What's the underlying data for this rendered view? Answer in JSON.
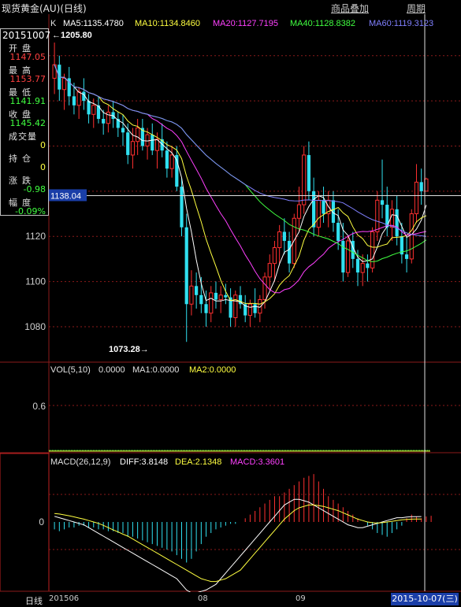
{
  "window": {
    "title": "现货黄金(AU)(日线)"
  },
  "menu": {
    "overlay": "商品叠加",
    "period": "周期"
  },
  "info_panel": {
    "date": "20151007",
    "open_label": "开盘",
    "open": "1147.05",
    "high_label": "最高",
    "high": "1153.77",
    "low_label": "最低",
    "low": "1141.91",
    "close_label": "收盘",
    "close": "1145.42",
    "volume_label": "成交量",
    "volume": "0",
    "position_label": "持仓",
    "position": "0",
    "change_label": "涨跌",
    "change": "-0.98",
    "pct_label": "幅度",
    "pct": "-0.09%"
  },
  "main_legend": {
    "k": "K",
    "ma5": "MA5:1135.4780",
    "ma10": "MA10:1134.8460",
    "ma20": "MA20:1127.7195",
    "ma40": "MA40:1128.8382",
    "ma60": "MA60:1119.3123"
  },
  "price_axis": [
    "1120",
    "1100",
    "1080"
  ],
  "cursor_price": "1138.04",
  "max_label": "1205.80",
  "min_label": "1073.28",
  "vol_legend": {
    "vol": "VOL(5,10)",
    "v": "0.0000",
    "ma1": "MA1:0.0000",
    "ma2": "MA2:0.0000"
  },
  "vol_axis": [
    "0.6"
  ],
  "macd_legend": {
    "name": "MACD(26,12,9)",
    "diff": "DIFF:3.8148",
    "dea": "DEA:2.1348",
    "macd": "MACD:3.3601"
  },
  "macd_axis": [
    "0"
  ],
  "time_axis": {
    "tab": "日线",
    "t1": "201506",
    "t2": "08",
    "t3": "09",
    "current": "2015-10-07(三)"
  },
  "colors": {
    "up": "#ff3030",
    "down": "#30e0f0",
    "ma5": "#ffffff",
    "ma10": "#ffff40",
    "ma20": "#ff40ff",
    "ma40": "#40ff40",
    "ma60": "#8080ff",
    "grid": "#8b1a1a"
  },
  "chart_data": {
    "type": "candlestick",
    "ma_periods": [
      5,
      10,
      20,
      40,
      60
    ],
    "candles": [
      {
        "o": 1190,
        "h": 1205.8,
        "l": 1183,
        "c": 1196
      },
      {
        "o": 1196,
        "h": 1200,
        "l": 1180,
        "c": 1185
      },
      {
        "o": 1185,
        "h": 1192,
        "l": 1176,
        "c": 1190
      },
      {
        "o": 1190,
        "h": 1195,
        "l": 1178,
        "c": 1182
      },
      {
        "o": 1182,
        "h": 1188,
        "l": 1174,
        "c": 1178
      },
      {
        "o": 1178,
        "h": 1186,
        "l": 1172,
        "c": 1184
      },
      {
        "o": 1184,
        "h": 1190,
        "l": 1176,
        "c": 1180
      },
      {
        "o": 1180,
        "h": 1183,
        "l": 1170,
        "c": 1174
      },
      {
        "o": 1174,
        "h": 1181,
        "l": 1168,
        "c": 1178
      },
      {
        "o": 1178,
        "h": 1182,
        "l": 1170,
        "c": 1172
      },
      {
        "o": 1172,
        "h": 1176,
        "l": 1165,
        "c": 1170
      },
      {
        "o": 1170,
        "h": 1178,
        "l": 1166,
        "c": 1175
      },
      {
        "o": 1175,
        "h": 1180,
        "l": 1168,
        "c": 1172
      },
      {
        "o": 1172,
        "h": 1175,
        "l": 1164,
        "c": 1168
      },
      {
        "o": 1168,
        "h": 1174,
        "l": 1160,
        "c": 1166
      },
      {
        "o": 1166,
        "h": 1170,
        "l": 1152,
        "c": 1156
      },
      {
        "o": 1156,
        "h": 1168,
        "l": 1150,
        "c": 1162
      },
      {
        "o": 1162,
        "h": 1172,
        "l": 1156,
        "c": 1168
      },
      {
        "o": 1168,
        "h": 1172,
        "l": 1158,
        "c": 1160
      },
      {
        "o": 1160,
        "h": 1168,
        "l": 1154,
        "c": 1165
      },
      {
        "o": 1165,
        "h": 1170,
        "l": 1156,
        "c": 1158
      },
      {
        "o": 1158,
        "h": 1166,
        "l": 1150,
        "c": 1163
      },
      {
        "o": 1163,
        "h": 1170,
        "l": 1155,
        "c": 1158
      },
      {
        "o": 1158,
        "h": 1162,
        "l": 1146,
        "c": 1150
      },
      {
        "o": 1150,
        "h": 1160,
        "l": 1146,
        "c": 1156
      },
      {
        "o": 1156,
        "h": 1160,
        "l": 1140,
        "c": 1142
      },
      {
        "o": 1142,
        "h": 1146,
        "l": 1120,
        "c": 1124
      },
      {
        "o": 1124,
        "h": 1130,
        "l": 1073.28,
        "c": 1090
      },
      {
        "o": 1090,
        "h": 1105,
        "l": 1085,
        "c": 1098
      },
      {
        "o": 1098,
        "h": 1104,
        "l": 1088,
        "c": 1094
      },
      {
        "o": 1094,
        "h": 1102,
        "l": 1086,
        "c": 1090
      },
      {
        "o": 1090,
        "h": 1096,
        "l": 1080,
        "c": 1086
      },
      {
        "o": 1086,
        "h": 1098,
        "l": 1082,
        "c": 1095
      },
      {
        "o": 1095,
        "h": 1100,
        "l": 1088,
        "c": 1092
      },
      {
        "o": 1092,
        "h": 1098,
        "l": 1086,
        "c": 1094
      },
      {
        "o": 1094,
        "h": 1099,
        "l": 1090,
        "c": 1093
      },
      {
        "o": 1093,
        "h": 1097,
        "l": 1080,
        "c": 1084
      },
      {
        "o": 1084,
        "h": 1096,
        "l": 1080,
        "c": 1094
      },
      {
        "o": 1094,
        "h": 1098,
        "l": 1088,
        "c": 1090
      },
      {
        "o": 1090,
        "h": 1094,
        "l": 1082,
        "c": 1085
      },
      {
        "o": 1085,
        "h": 1092,
        "l": 1080,
        "c": 1090
      },
      {
        "o": 1090,
        "h": 1097,
        "l": 1084,
        "c": 1086
      },
      {
        "o": 1086,
        "h": 1094,
        "l": 1082,
        "c": 1092
      },
      {
        "o": 1092,
        "h": 1104,
        "l": 1088,
        "c": 1102
      },
      {
        "o": 1102,
        "h": 1112,
        "l": 1096,
        "c": 1108
      },
      {
        "o": 1108,
        "h": 1118,
        "l": 1100,
        "c": 1115
      },
      {
        "o": 1115,
        "h": 1125,
        "l": 1108,
        "c": 1122
      },
      {
        "o": 1122,
        "h": 1128,
        "l": 1112,
        "c": 1118
      },
      {
        "o": 1118,
        "h": 1122,
        "l": 1104,
        "c": 1108
      },
      {
        "o": 1108,
        "h": 1130,
        "l": 1106,
        "c": 1128
      },
      {
        "o": 1128,
        "h": 1142,
        "l": 1122,
        "c": 1134
      },
      {
        "o": 1134,
        "h": 1160,
        "l": 1130,
        "c": 1156
      },
      {
        "o": 1156,
        "h": 1162,
        "l": 1136,
        "c": 1140
      },
      {
        "o": 1140,
        "h": 1146,
        "l": 1120,
        "c": 1124
      },
      {
        "o": 1124,
        "h": 1140,
        "l": 1120,
        "c": 1136
      },
      {
        "o": 1136,
        "h": 1142,
        "l": 1126,
        "c": 1130
      },
      {
        "o": 1130,
        "h": 1140,
        "l": 1124,
        "c": 1136
      },
      {
        "o": 1136,
        "h": 1140,
        "l": 1122,
        "c": 1126
      },
      {
        "o": 1126,
        "h": 1132,
        "l": 1114,
        "c": 1118
      },
      {
        "o": 1118,
        "h": 1126,
        "l": 1100,
        "c": 1104
      },
      {
        "o": 1104,
        "h": 1120,
        "l": 1102,
        "c": 1118
      },
      {
        "o": 1118,
        "h": 1122,
        "l": 1106,
        "c": 1110
      },
      {
        "o": 1110,
        "h": 1114,
        "l": 1098,
        "c": 1104
      },
      {
        "o": 1104,
        "h": 1112,
        "l": 1098,
        "c": 1108
      },
      {
        "o": 1108,
        "h": 1112,
        "l": 1100,
        "c": 1106
      },
      {
        "o": 1106,
        "h": 1124,
        "l": 1104,
        "c": 1122
      },
      {
        "o": 1122,
        "h": 1140,
        "l": 1118,
        "c": 1136
      },
      {
        "o": 1136,
        "h": 1154,
        "l": 1128,
        "c": 1134
      },
      {
        "o": 1134,
        "h": 1142,
        "l": 1120,
        "c": 1124
      },
      {
        "o": 1124,
        "h": 1136,
        "l": 1118,
        "c": 1132
      },
      {
        "o": 1132,
        "h": 1138,
        "l": 1116,
        "c": 1120
      },
      {
        "o": 1120,
        "h": 1126,
        "l": 1108,
        "c": 1112
      },
      {
        "o": 1112,
        "h": 1120,
        "l": 1104,
        "c": 1110
      },
      {
        "o": 1110,
        "h": 1132,
        "l": 1108,
        "c": 1130
      },
      {
        "o": 1130,
        "h": 1152,
        "l": 1126,
        "c": 1144
      },
      {
        "o": 1144,
        "h": 1150,
        "l": 1134,
        "c": 1140
      },
      {
        "o": 1140,
        "h": 1146,
        "l": 1141.91,
        "c": 1145.42
      }
    ],
    "macd_hist": [
      -4,
      -5,
      -4,
      -3,
      -3,
      -2,
      -2,
      -3,
      -3,
      -4,
      -4,
      -5,
      -5,
      -6,
      -6,
      -8,
      -8,
      -9,
      -10,
      -11,
      -12,
      -13,
      -14,
      -15,
      -16,
      -18,
      -20,
      -22,
      -20,
      -16,
      -12,
      -8,
      -6,
      -4,
      -3,
      -2,
      -1,
      -1,
      0,
      2,
      4,
      6,
      8,
      10,
      12,
      14,
      14,
      16,
      18,
      20,
      22,
      24,
      25,
      26,
      22,
      18,
      14,
      12,
      10,
      8,
      6,
      4,
      2,
      0,
      -2,
      -4,
      -6,
      -7,
      -8,
      -6,
      -4,
      -2,
      2,
      4,
      3,
      2,
      3,
      3.36
    ],
    "diff": [
      4,
      3,
      2,
      1,
      0,
      -1,
      -2,
      -4,
      -6,
      -8,
      -10,
      -12,
      -14,
      -16,
      -18,
      -20,
      -22,
      -24,
      -26,
      -28,
      -30,
      -32,
      -34,
      -36,
      -38,
      -40,
      -44,
      -48,
      -50,
      -50,
      -49,
      -48,
      -46,
      -44,
      -40,
      -36,
      -32,
      -28,
      -24,
      -20,
      -16,
      -12,
      -8,
      -4,
      0,
      4,
      8,
      12,
      14,
      16,
      16,
      15,
      14,
      12,
      10,
      8,
      6,
      4,
      2,
      0,
      -2,
      -3,
      -4,
      -4,
      -3,
      -2,
      -1,
      0,
      1,
      2,
      3,
      3,
      3.5,
      3.8,
      3.8,
      3.81
    ],
    "dea": [
      6,
      5.6,
      5,
      4.4,
      3.6,
      2.8,
      2,
      1,
      0,
      -1,
      -2.4,
      -4,
      -5.6,
      -7,
      -8.6,
      -10,
      -12,
      -14,
      -16,
      -18,
      -20,
      -22,
      -24,
      -26,
      -28,
      -30,
      -32,
      -34,
      -36,
      -38,
      -40,
      -41,
      -42,
      -42,
      -41,
      -40,
      -38,
      -36,
      -34,
      -30,
      -26,
      -22,
      -18,
      -14,
      -10,
      -6,
      -2,
      2,
      5,
      8,
      10,
      11,
      12,
      12,
      11.5,
      11,
      10,
      9,
      8,
      6.5,
      5,
      3.5,
      2,
      1,
      0,
      -0.5,
      -0.8,
      -0.5,
      0,
      0.5,
      1,
      1.5,
      1.8,
      2,
      2.1,
      2.13
    ]
  }
}
